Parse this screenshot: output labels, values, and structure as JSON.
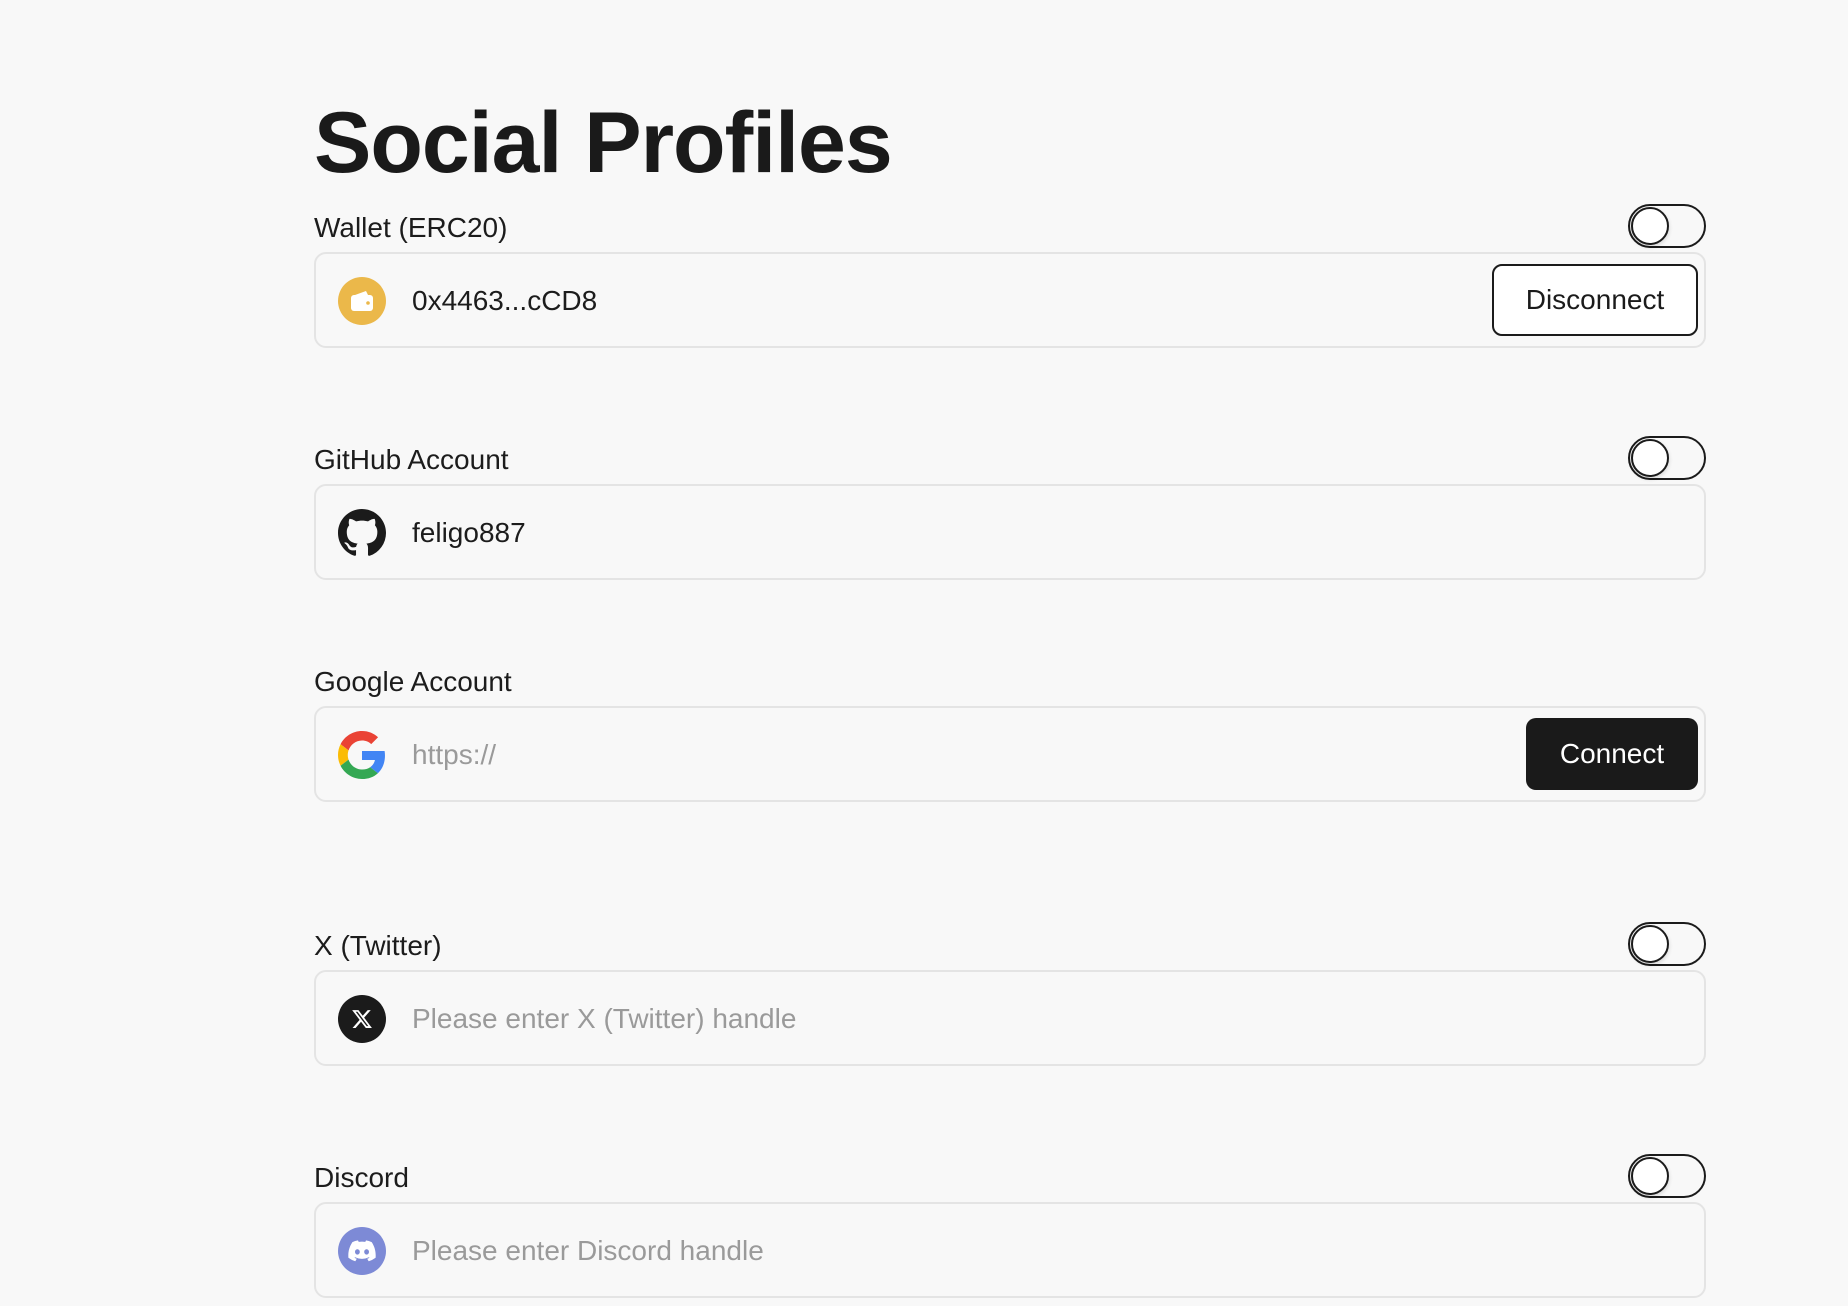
{
  "page": {
    "title": "Social Profiles"
  },
  "colors": {
    "background": "#f8f8f8",
    "text": "#1b1b1b",
    "placeholder": "#9a9a9a",
    "border": "#e4e4e4",
    "wallet_icon_bg": "#ebb84a",
    "discord_icon_bg": "#7d8ad6",
    "connect_button_bg": "#1a1a1a"
  },
  "sections": {
    "wallet": {
      "label": "Wallet (ERC20)",
      "icon": "wallet-icon",
      "value": "0x4463...cCD8",
      "button_label": "Disconnect",
      "toggle_on": false
    },
    "github": {
      "label": "GitHub Account",
      "icon": "github-icon",
      "value": "feligo887",
      "toggle_on": false
    },
    "google": {
      "label": "Google Account",
      "icon": "google-icon",
      "placeholder": "https://",
      "button_label": "Connect"
    },
    "twitter": {
      "label": "X (Twitter)",
      "icon": "x-icon",
      "placeholder": "Please enter X (Twitter) handle",
      "toggle_on": false
    },
    "discord": {
      "label": "Discord",
      "icon": "discord-icon",
      "placeholder": "Please enter Discord handle",
      "toggle_on": false
    }
  }
}
